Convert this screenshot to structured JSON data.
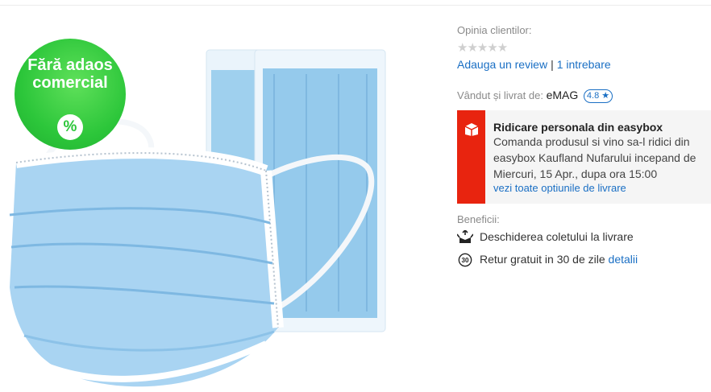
{
  "badge": {
    "text": "Fără adaos comercial",
    "icon": "%"
  },
  "reviews": {
    "label": "Opinia clientilor:",
    "stars": "★★★★★",
    "add_review": "Adauga un review",
    "separator": "|",
    "questions": "1 intrebare"
  },
  "seller": {
    "label": "Vândut și livrat de:",
    "name": "eMAG",
    "rating": "4.8 ★"
  },
  "easybox": {
    "title": "Ridicare personala din easybox",
    "description": "Comanda produsul si vino sa-l ridici din easybox Kaufland Nufarului incepand de Miercuri, 15 Apr., dupa ora 15:00",
    "link": "vezi toate optiunile de livrare",
    "icon": "box-icon"
  },
  "benefits": {
    "label": "Beneficii:",
    "items": [
      {
        "icon": "open-package-icon",
        "text": "Deschiderea coletului la livrare"
      },
      {
        "icon": "return-30-icon",
        "text": "Retur gratuit in 30 de zile",
        "link": "detalii"
      }
    ]
  },
  "colors": {
    "accent": "#1a6fc4",
    "easybox_red": "#e8240f",
    "badge_green": "#2cc63a"
  }
}
